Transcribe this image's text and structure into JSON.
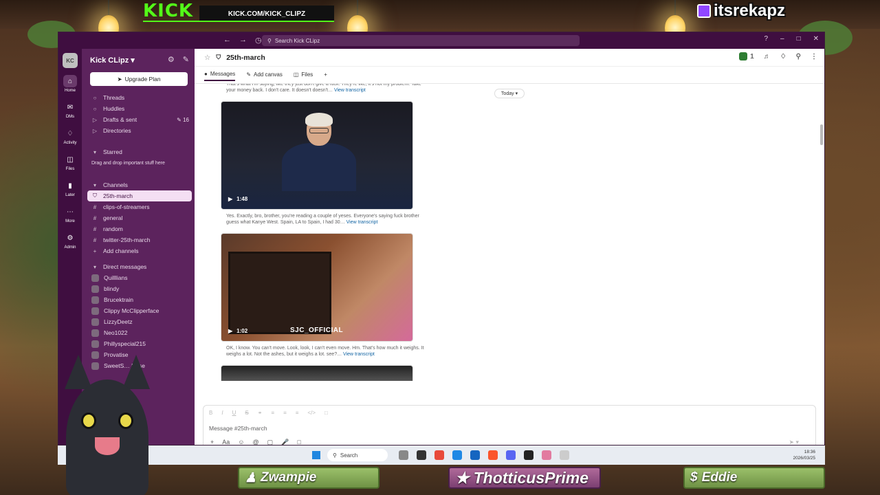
{
  "overlay": {
    "kick_logo": "KICK",
    "kick_url": "KICK.COM/KICK_CLIPZ",
    "twitch_name": "itsrekapz",
    "plates": [
      "Zwampie",
      "ThotticusPrime",
      "Eddie"
    ]
  },
  "titlebar": {
    "search_placeholder": "Search Kick CLipz"
  },
  "rail": {
    "workspace_initials": "KC",
    "items": [
      "Home",
      "DMs",
      "Activity",
      "Files",
      "Later",
      "More",
      "Admin"
    ]
  },
  "sidebar": {
    "workspace_name": "Kick CLipz",
    "upgrade": "Upgrade Plan",
    "nav": [
      "Threads",
      "Huddles",
      "Drafts & sent",
      "Directories"
    ],
    "drafts_count": "16",
    "starred": "Starred",
    "starred_hint": "Drag and drop important stuff here",
    "channels_header": "Channels",
    "channels": [
      "25th-march",
      "clips-of-streamers",
      "general",
      "random",
      "twitter-25th-march"
    ],
    "add_channels": "Add channels",
    "dm_header": "Direct messages",
    "dms": [
      "Quilllians",
      "blindy",
      "Brucektrain",
      "Clippy McClipperface",
      "LizzyDeetz",
      "Neo1022",
      "Phillyspecial215",
      "Provatise",
      "SweetS… Rose"
    ]
  },
  "channel": {
    "name": "25th-march",
    "member_count": "1",
    "tabs": [
      "Messages",
      "Add canvas",
      "Files"
    ],
    "date_divider": "Today"
  },
  "feed": {
    "caption0": "That's what I'm saying, like they just don't give a fuck. They're like, it's not my problem. Take your money back. I don't care. It doesn't doesn't…",
    "caption1": "Yes. Exactly, bro, brother, you're reading a couple of yeses. Everyone's saying fuck brother guess what Kanye West. Spain, LA to Spain, I had 30…",
    "caption2": "OK, I know. You can't move. Look, look, I can't even move. Hm. That's how much it weighs. It weighs a lot. Not the ashes, but it weighs a lot. see?…",
    "view_transcript": "View transcript",
    "video1_duration": "1:48",
    "video2_duration": "1:02",
    "video2_watermark": "SJC_OFFICIAL"
  },
  "composer": {
    "placeholder": "Message #25th-march"
  },
  "taskbar": {
    "search": "Search",
    "time": "18:36",
    "date": "2026/03/25"
  }
}
